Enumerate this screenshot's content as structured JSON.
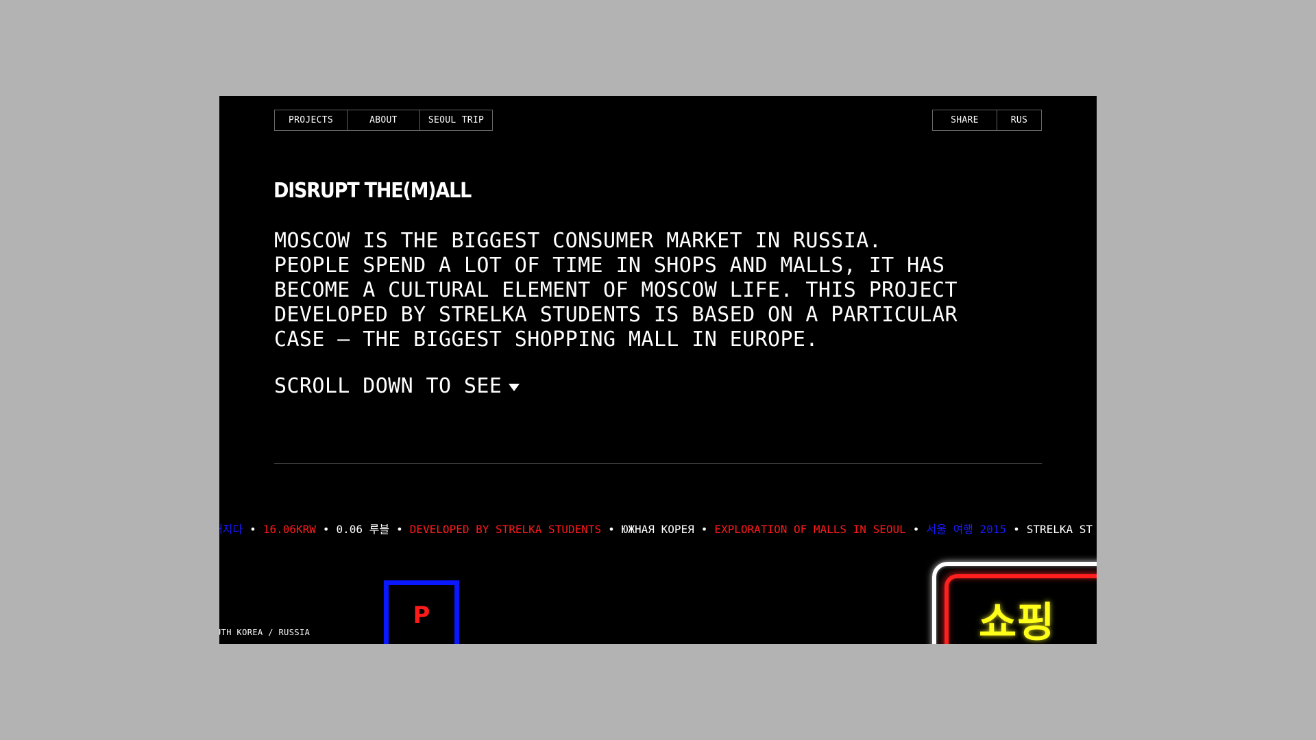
{
  "nav": {
    "left": [
      "PROJECTS",
      "ABOUT",
      "SEOUL TRIP"
    ],
    "right": [
      "SHARE",
      "RUS"
    ]
  },
  "brand": {
    "logo": "DISRUPT THE(M)ALL"
  },
  "intro": {
    "lines": [
      "MOSCOW IS THE BIGGEST CONSUMER MARKET IN RUSSIA.",
      "PEOPLE SPEND A LOT OF TIME IN SHOPS AND MALLS, IT HAS",
      "BECOME A CULTURAL ELEMENT OF MOSCOW LIFE. THIS PROJECT",
      "DEVELOPED BY STRELKA STUDENTS IS BASED ON A PARTICULAR",
      "CASE – THE BIGGEST SHOPPING MALL IN EUROPE."
    ],
    "scroll_cta": "SCROLL DOWN TO SEE"
  },
  "ticker": [
    {
      "text": "내지다",
      "color": "blue"
    },
    {
      "text": "16.06KRW",
      "color": "red"
    },
    {
      "text": "0.06 루블",
      "color": "white"
    },
    {
      "text": "DEVELOPED BY STRELKA STUDENTS",
      "color": "red"
    },
    {
      "text": "ЮЖНАЯ КОРЕЯ",
      "color": "white"
    },
    {
      "text": "EXPLORATION OF MALLS IN SEOUL",
      "color": "red"
    },
    {
      "text": "서울 여행 2015",
      "color": "blue"
    },
    {
      "text": "STRELKA ST",
      "color": "white"
    }
  ],
  "ticker_separator": "•",
  "caption": {
    "country": "UTH KOREA / RUSSIA"
  },
  "signs": {
    "blue_letter": "P",
    "neon_text": "쇼핑"
  },
  "colors": {
    "background": "#000000",
    "page_bg": "#b3b3b3",
    "blue": "#1a1aff",
    "red": "#ff1a1a",
    "yellow": "#ffff1a"
  }
}
